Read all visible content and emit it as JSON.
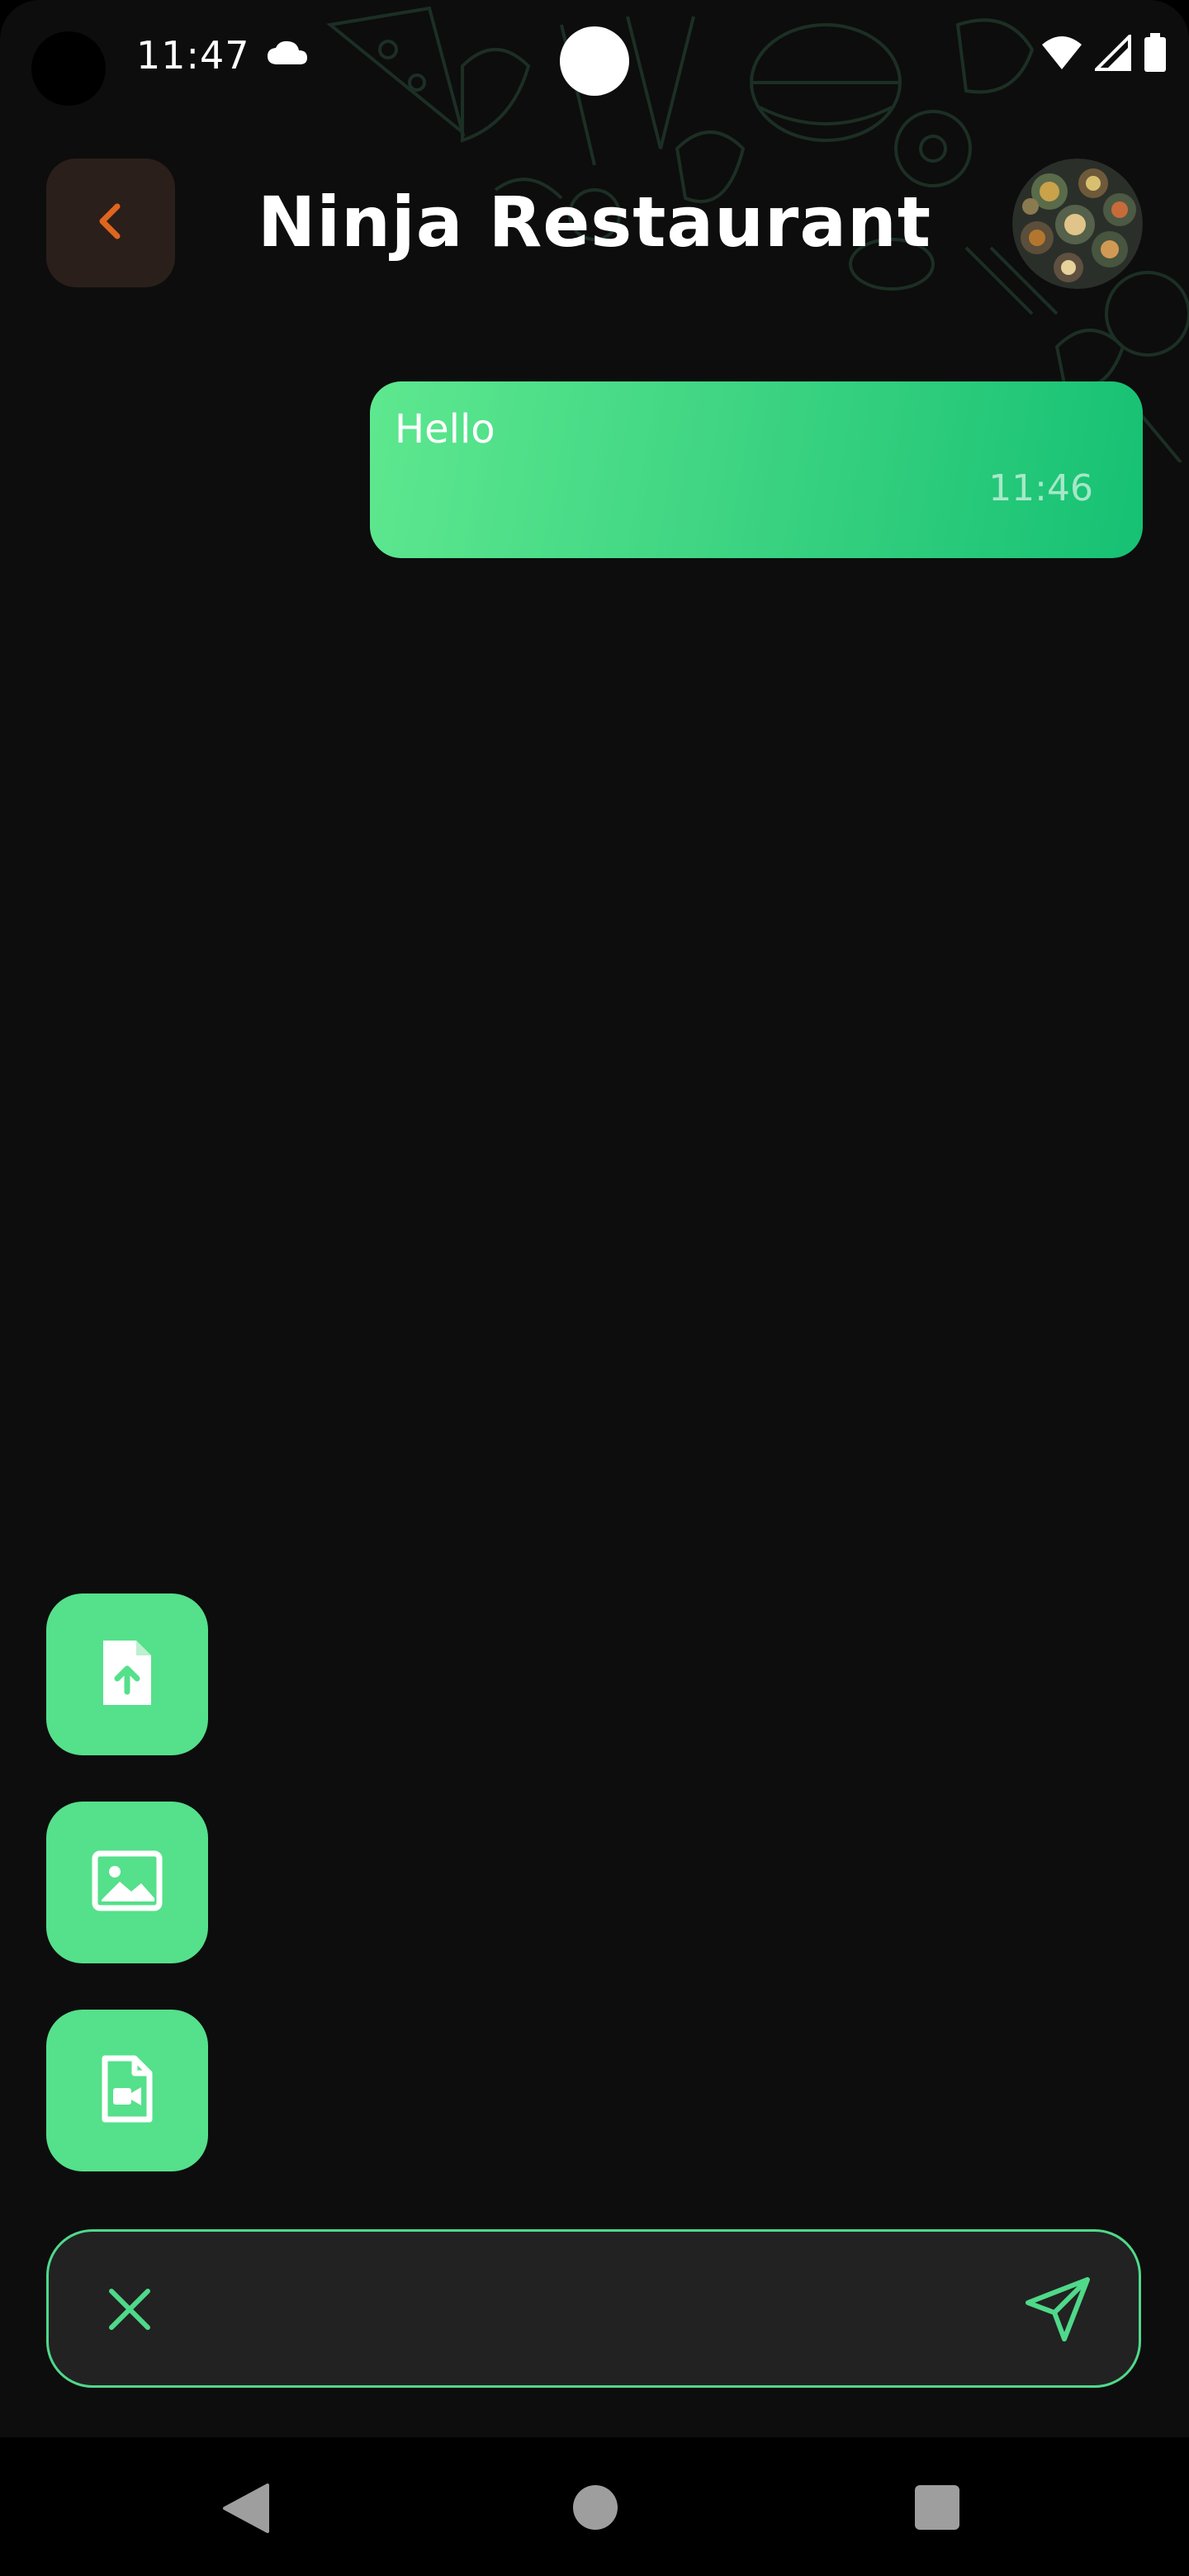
{
  "status_bar": {
    "time": "11:47",
    "icons": [
      "cloud-icon",
      "wifi-icon",
      "cell-signal-icon",
      "battery-icon"
    ]
  },
  "header": {
    "title": "Ninja Restaurant",
    "back_icon": "chevron-left-icon",
    "avatar_icon": "restaurant-avatar"
  },
  "messages": [
    {
      "text": "Hello",
      "time": "11:46",
      "direction": "outgoing"
    }
  ],
  "attachments": [
    {
      "name": "upload-file",
      "icon": "file-upload-icon"
    },
    {
      "name": "upload-image",
      "icon": "image-icon"
    },
    {
      "name": "upload-video",
      "icon": "video-file-icon"
    }
  ],
  "composer": {
    "value": "",
    "placeholder": "",
    "close_icon": "close-icon",
    "send_icon": "send-icon"
  },
  "nav_bar": {
    "icons": [
      "back-triangle-icon",
      "home-circle-icon",
      "recents-square-icon"
    ]
  },
  "colors": {
    "background": "#0d0d0d",
    "accent_green": "#55e08b",
    "bubble_gradient_start": "#5ee88f",
    "bubble_gradient_end": "#16c173",
    "back_button_bg": "#2a1f1b",
    "back_chevron": "#e0651e",
    "composer_bg": "#222222"
  }
}
